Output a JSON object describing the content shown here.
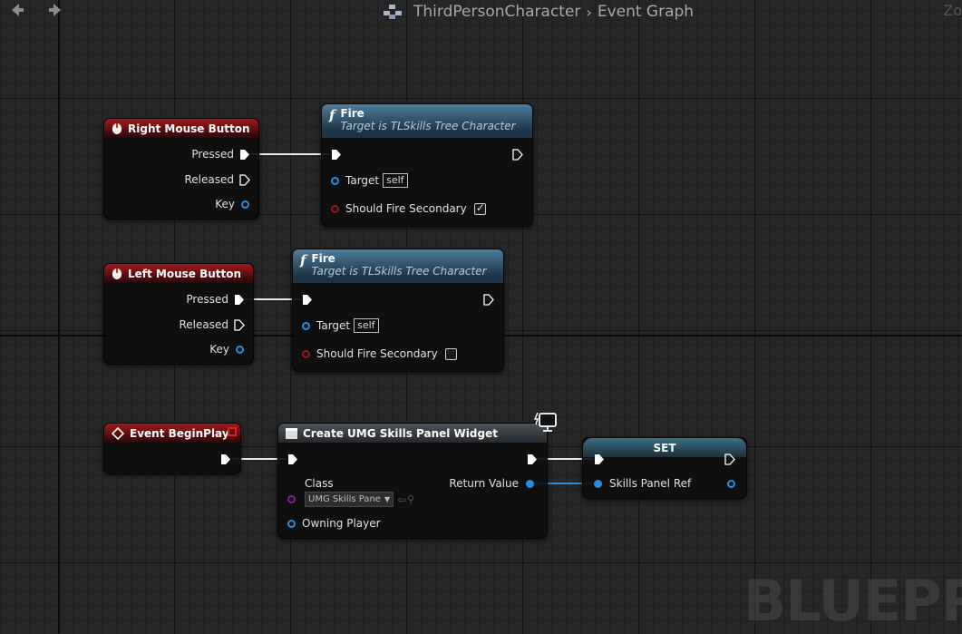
{
  "breadcrumb": {
    "blueprint": "ThirdPersonCharacter",
    "graph": "Event Graph",
    "zoom": "Zo"
  },
  "watermark": "BLUEPRIN",
  "nodes": {
    "rmb": {
      "title": "Right Mouse Button",
      "pressed": "Pressed",
      "released": "Released",
      "key": "Key"
    },
    "fire1": {
      "title": "Fire",
      "subtitle": "Target is TLSkills Tree Character",
      "target": "Target",
      "target_default": "self",
      "secondary": "Should Fire Secondary",
      "secondary_checked": true
    },
    "lmb": {
      "title": "Left Mouse Button",
      "pressed": "Pressed",
      "released": "Released",
      "key": "Key"
    },
    "fire2": {
      "title": "Fire",
      "subtitle": "Target is TLSkills Tree Character",
      "target": "Target",
      "target_default": "self",
      "secondary": "Should Fire Secondary",
      "secondary_checked": false
    },
    "beginplay": {
      "title": "Event BeginPlay"
    },
    "create": {
      "title": "Create UMG Skills Panel Widget",
      "class": "Class",
      "class_value": "UMG Skills Pane",
      "return": "Return Value",
      "owning": "Owning Player"
    },
    "set": {
      "title": "SET",
      "var": "Skills Panel Ref"
    }
  },
  "colors": {
    "exec": "#ffffff",
    "object": "#2a8fe0",
    "bool": "#9a1515",
    "class": "#7d1ca8",
    "event_header": "#a21a1a",
    "function_header": "#4f7c9c"
  }
}
